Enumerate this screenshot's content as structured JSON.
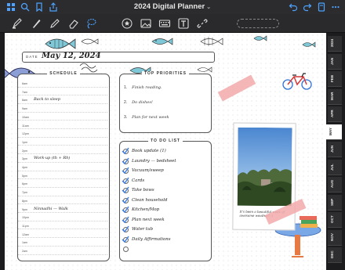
{
  "topbar": {
    "title": "2024 Digital Planner",
    "title_chevron": "⌄",
    "left_icons": [
      "grid-icon",
      "search-icon",
      "bookmark-icon",
      "share-icon"
    ],
    "right_icons": [
      "undo-icon",
      "redo-icon",
      "page-icon",
      "more-icon"
    ]
  },
  "toolbar": {
    "tools": [
      "pen-icon",
      "pen-tool-icon",
      "pencil-icon",
      "eraser-icon",
      "lasso-icon",
      "star-shapes-icon",
      "image-icon",
      "keyboard-icon",
      "text-icon",
      "link-icon"
    ]
  },
  "planner": {
    "date_label": "DATE",
    "date_value": "May 12, 2024",
    "schedule_title": "SCHEDULE",
    "priorities_title": "TOP PRIORITIES",
    "todo_title": "TO DO LIST",
    "schedule": [
      {
        "time": "6am",
        "note": ""
      },
      {
        "time": "7am",
        "note": ""
      },
      {
        "time": "8am",
        "note": "Back to sleep"
      },
      {
        "time": "9am",
        "note": ""
      },
      {
        "time": "10am",
        "note": ""
      },
      {
        "time": "11am",
        "note": ""
      },
      {
        "time": "12pm",
        "note": ""
      },
      {
        "time": "1pm",
        "note": ""
      },
      {
        "time": "2pm",
        "note": ""
      },
      {
        "time": "3pm",
        "note": "Work-up (th + Rh)"
      },
      {
        "time": "4pm",
        "note": ""
      },
      {
        "time": "5pm",
        "note": ""
      },
      {
        "time": "6pm",
        "note": ""
      },
      {
        "time": "7pm",
        "note": ""
      },
      {
        "time": "8pm",
        "note": ""
      },
      {
        "time": "9pm",
        "note": "Ninnadhi — Walk"
      },
      {
        "time": "10pm",
        "note": ""
      },
      {
        "time": "11pm",
        "note": ""
      },
      {
        "time": "12am",
        "note": ""
      },
      {
        "time": "1am",
        "note": ""
      },
      {
        "time": "2am",
        "note": ""
      }
    ],
    "priorities": [
      {
        "num": "1.",
        "text": "Finish reading."
      },
      {
        "num": "2.",
        "text": "Do dishes!"
      },
      {
        "num": "3.",
        "text": "Plan for next week"
      }
    ],
    "todos": [
      {
        "text": "Book update (1)",
        "done": true
      },
      {
        "text": "Laundry — bedsheet",
        "done": true
      },
      {
        "text": "Vacuum/sweep",
        "done": true
      },
      {
        "text": "Cards",
        "done": true
      },
      {
        "text": "Take bows",
        "done": true
      },
      {
        "text": "Clean household",
        "done": true
      },
      {
        "text": "Kitchen/Mop",
        "done": true
      },
      {
        "text": "Plan next week",
        "done": true
      },
      {
        "text": "Water tub",
        "done": true
      },
      {
        "text": "Daily Affirmations",
        "done": true
      },
      {
        "text": "",
        "done": false
      }
    ],
    "photo_caption": "It's been a beautiful week of awesome weather! :)"
  },
  "months": [
    "2024",
    "JAN",
    "FEB",
    "MAR",
    "APR",
    "MAY",
    "JUN",
    "JUL",
    "AUG",
    "SEP",
    "OCT",
    "NOV",
    "DEC"
  ],
  "active_month": "MAY",
  "colors": {
    "accent": "#4da3ff",
    "tape": "#f2a9a9",
    "check": "#3a7be0",
    "fish": "#7ec8d8",
    "toolbar": "#2a2a2c"
  }
}
